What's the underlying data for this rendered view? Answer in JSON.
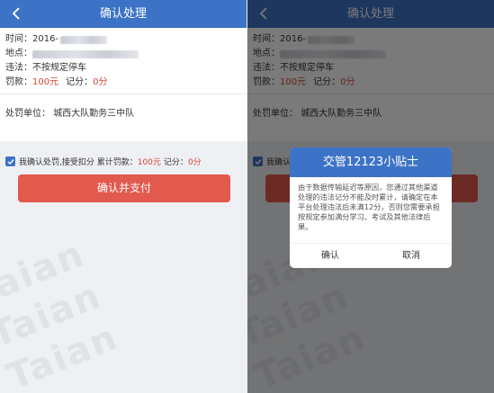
{
  "nav": {
    "title": "确认处理"
  },
  "info": {
    "time_label": "时间：",
    "time_value": "2016-",
    "place_label": "地点：",
    "violation_label": "违法：",
    "violation_value": "不按规定停车",
    "fine_label": "罚款：",
    "fine_value": "100元",
    "points_label": "记分：",
    "points_value": "0分"
  },
  "unit": {
    "label": "处罚单位：",
    "value": "城西大队勤务三中队"
  },
  "agree": {
    "text": "我确认处罚,接受扣分 累计罚款：",
    "fine_value": "100元",
    "points_label": "记分：",
    "points_value": "0分"
  },
  "pay_button": {
    "label": "确认并支付"
  },
  "watermark": {
    "text": "Taian"
  },
  "dialog": {
    "title": "交管12123小贴士",
    "body": "由于数据传输延迟等原因，您通过其他渠道处理的违法记分不能及时累计，请确定在本平台处理违法后未满12分，否则您需要承担按规定参加满分学习、考试及其他法律后果。",
    "confirm_label": "确认",
    "cancel_label": "取消"
  },
  "colors": {
    "nav": "#3d73c6",
    "pay_button": "#e2594d",
    "accent_red": "#d64535"
  }
}
